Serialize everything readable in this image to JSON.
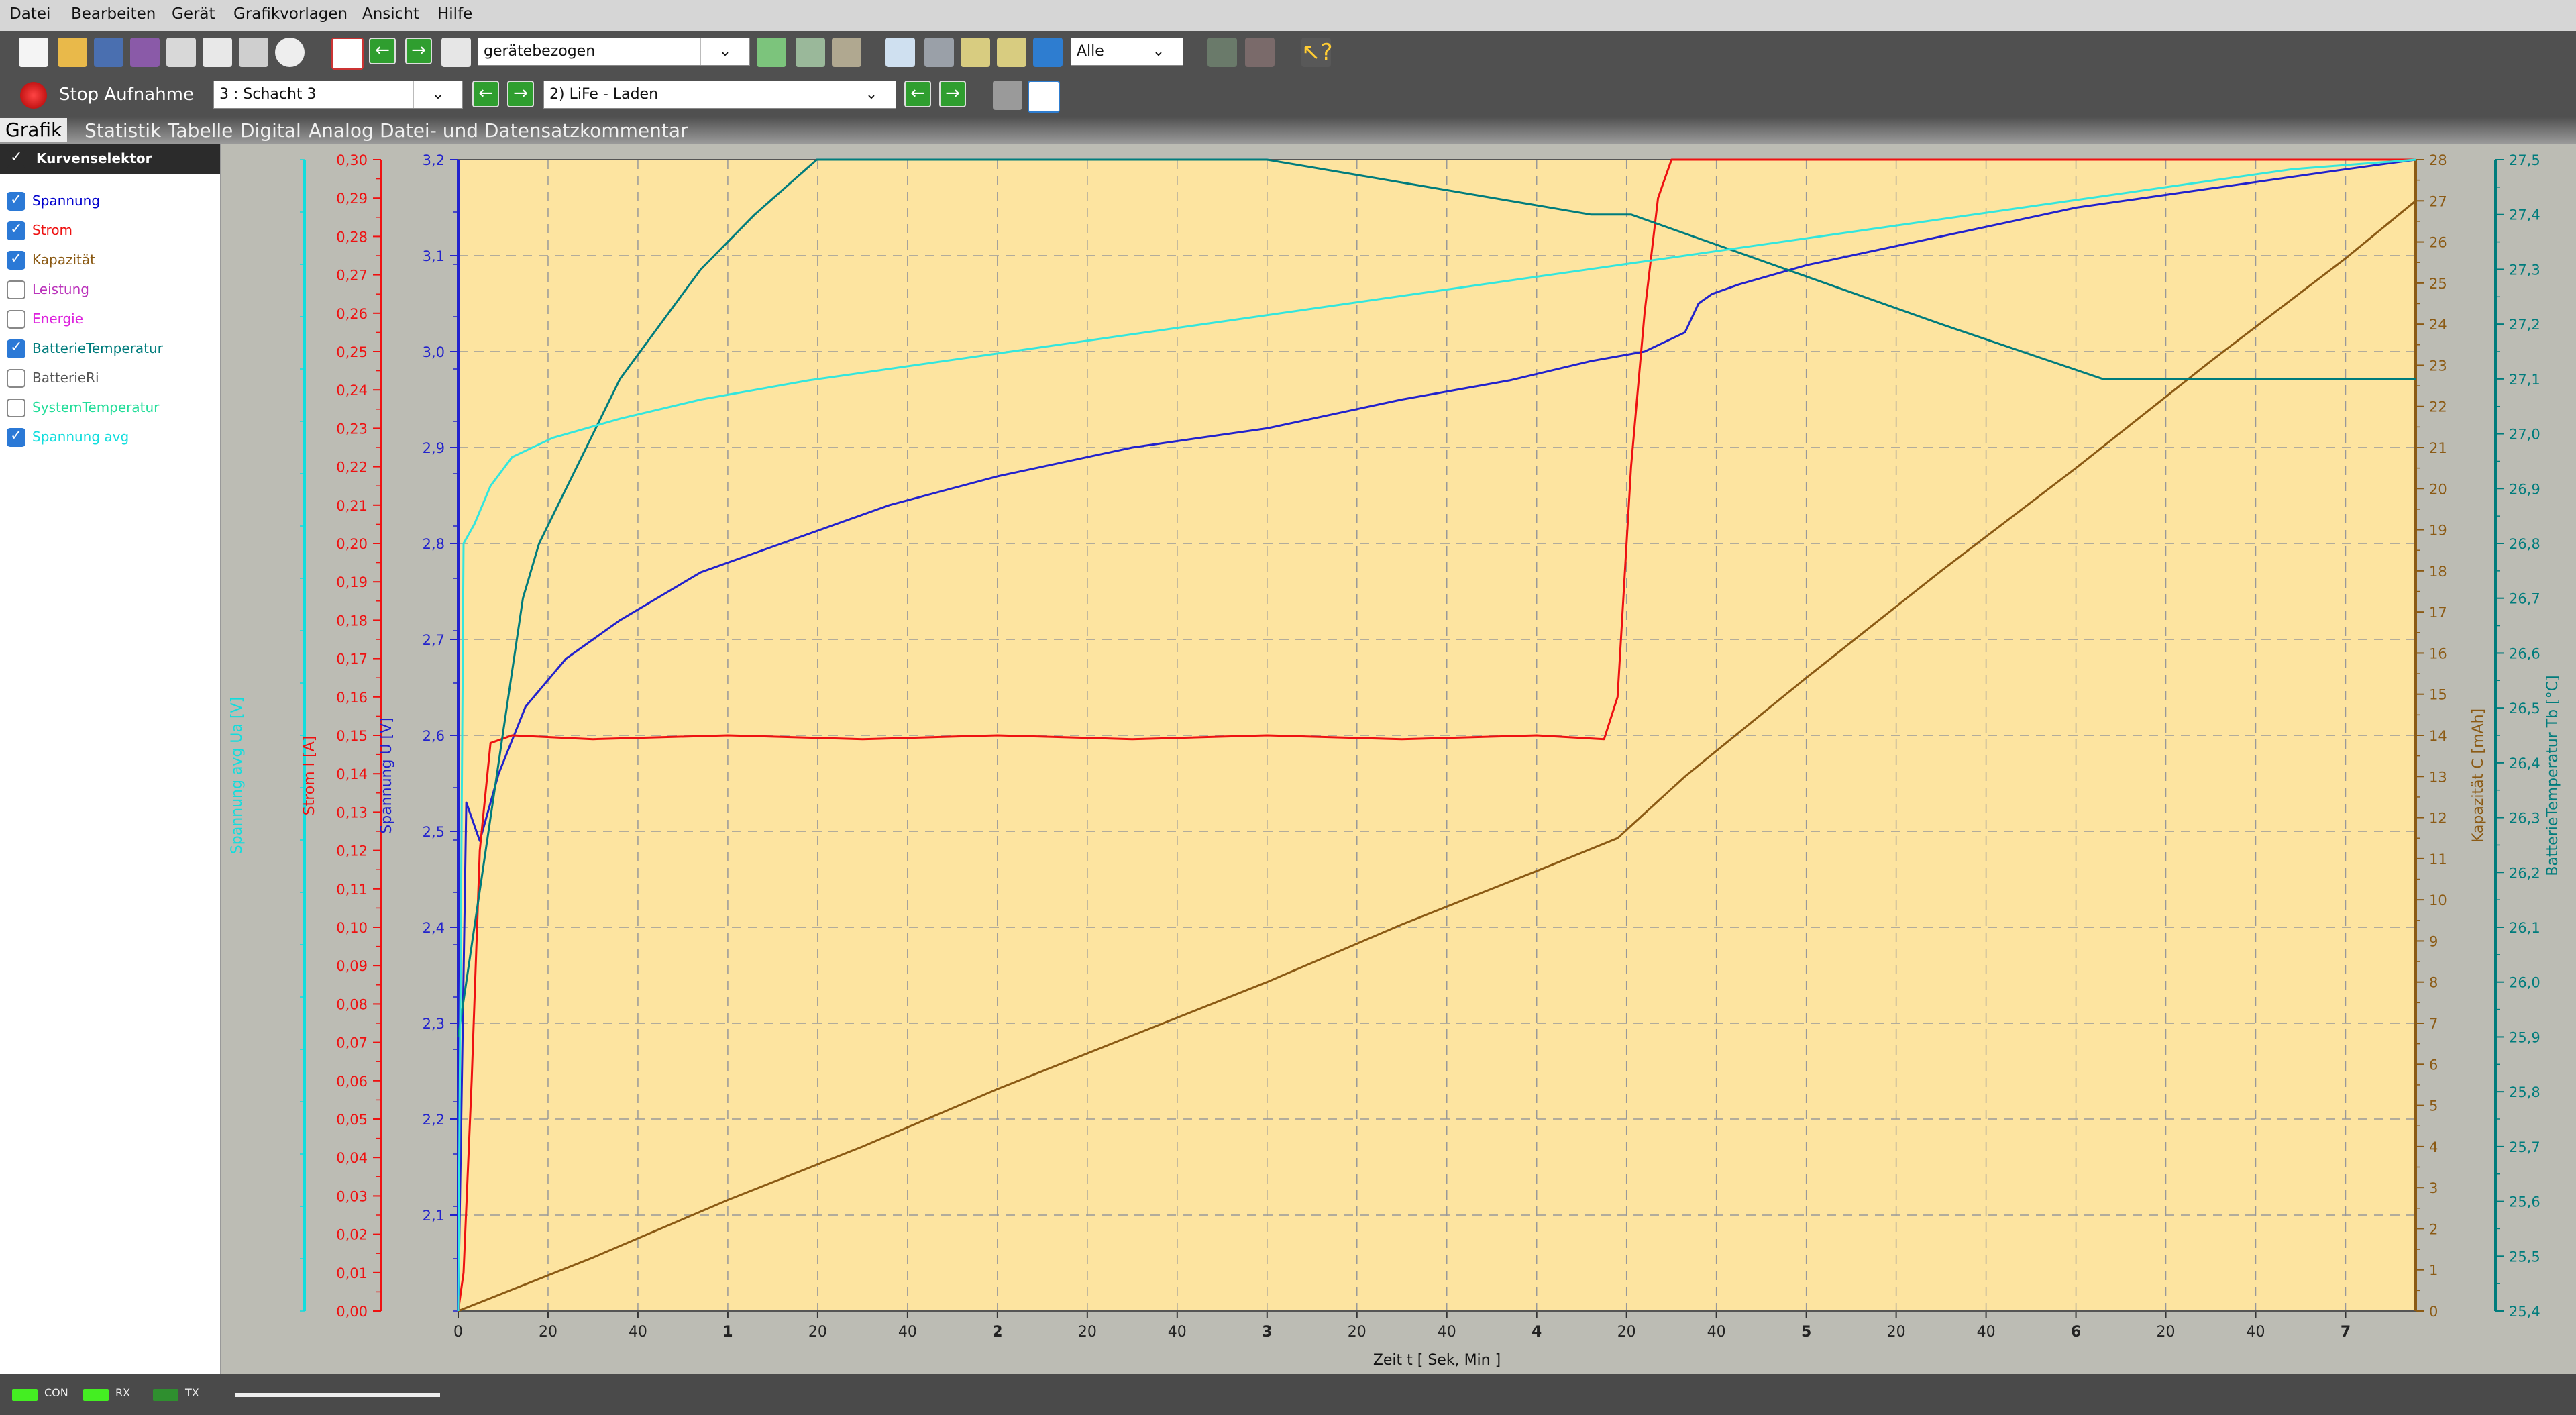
{
  "menu": [
    "Datei",
    "Bearbeiten",
    "Gerät",
    "Grafikvorlagen",
    "Ansicht",
    "Hilfe"
  ],
  "toolbar1": {
    "template_combo": "gerätebezogen",
    "filter_combo": "Alle"
  },
  "toolbar2": {
    "record_button": "Stop Aufnahme",
    "channel_combo": "3 : Schacht 3",
    "record_set_combo": "2) LiFe - Laden"
  },
  "tabs": [
    "Grafik",
    "Statistik",
    "Tabelle",
    "Digital",
    "Analog",
    "Datei- und Datensatzkommentar"
  ],
  "sidebar": {
    "header": "Kurvenselektor",
    "items": [
      {
        "label": "Spannung",
        "checked": true,
        "color": "#0000cc"
      },
      {
        "label": "Strom",
        "checked": true,
        "color": "#ee1111"
      },
      {
        "label": "Kapazität",
        "checked": true,
        "color": "#8b5a14"
      },
      {
        "label": "Leistung",
        "checked": false,
        "color": "#bb33bb"
      },
      {
        "label": "Energie",
        "checked": false,
        "color": "#dd22dd"
      },
      {
        "label": "BatterieTemperatur",
        "checked": true,
        "color": "#007c7c"
      },
      {
        "label": "BatterieRi",
        "checked": false,
        "color": "#555555"
      },
      {
        "label": "SystemTemperatur",
        "checked": false,
        "color": "#22dd99"
      },
      {
        "label": "Spannung avg",
        "checked": true,
        "color": "#11dddd"
      }
    ]
  },
  "status": {
    "con": "CON",
    "rx": "RX",
    "tx": "TX"
  },
  "chart_data": {
    "type": "line",
    "background": "#fde4a0",
    "grid": true,
    "xlabel": "Zeit   t   [ Sek, Min ]",
    "x_ticks": [
      "0",
      "20",
      "40",
      "1",
      "20",
      "40",
      "2",
      "20",
      "40",
      "3",
      "20",
      "40",
      "4",
      "20",
      "40",
      "5",
      "20",
      "40",
      "6",
      "20",
      "40",
      "7"
    ],
    "axes": [
      {
        "id": "spannung_avg",
        "label": "Spannung avg  Ua  [V]",
        "side": "left",
        "color": "#11dddd",
        "range": [
          0,
          3.2
        ]
      },
      {
        "id": "strom",
        "label": "Strom   I   [A]",
        "side": "left",
        "color": "#ee1111",
        "range": [
          0,
          0.3
        ],
        "ticks": [
          "0,00",
          "0,01",
          "0,02",
          "0,03",
          "0,04",
          "0,05",
          "0,06",
          "0,07",
          "0,08",
          "0,09",
          "0,10",
          "0,11",
          "0,12",
          "0,13",
          "0,14",
          "0,15",
          "0,16",
          "0,17",
          "0,18",
          "0,19",
          "0,20",
          "0,21",
          "0,22",
          "0,23",
          "0,24",
          "0,25",
          "0,26",
          "0,27",
          "0,28",
          "0,29",
          "0,30"
        ]
      },
      {
        "id": "spannung",
        "label": "Spannung   U   [V]",
        "side": "left",
        "color": "#2222cc",
        "range": [
          2.0,
          3.2
        ],
        "ticks": [
          "2,1",
          "2,2",
          "2,3",
          "2,4",
          "2,5",
          "2,6",
          "2,7",
          "2,8",
          "2,9",
          "3,0",
          "3,1",
          "3,2"
        ]
      },
      {
        "id": "kapazitaet",
        "label": "Kapazität   C   [mAh]",
        "side": "right",
        "color": "#8b5a14",
        "range": [
          0,
          28
        ],
        "ticks": [
          "0",
          "1",
          "2",
          "3",
          "4",
          "5",
          "6",
          "7",
          "8",
          "9",
          "10",
          "11",
          "12",
          "13",
          "14",
          "15",
          "16",
          "17",
          "18",
          "19",
          "20",
          "21",
          "22",
          "23",
          "24",
          "25",
          "26",
          "27",
          "28"
        ]
      },
      {
        "id": "temperatur",
        "label": "BatterieTemperatur   Tb   [°C]",
        "side": "right",
        "color": "#007c7c",
        "range": [
          25.4,
          27.5
        ],
        "ticks": [
          "25,4",
          "25,5",
          "25,6",
          "25,7",
          "25,8",
          "25,9",
          "26,0",
          "26,1",
          "26,2",
          "26,3",
          "26,4",
          "26,5",
          "26,6",
          "26,7",
          "26,8",
          "26,9",
          "27,0",
          "27,1",
          "27,2",
          "27,3",
          "27,4",
          "27,5"
        ]
      }
    ],
    "series": [
      {
        "name": "Spannung",
        "axis": "spannung",
        "color": "#2222cc",
        "x": [
          0,
          0.03,
          0.08,
          0.15,
          0.25,
          0.4,
          0.6,
          0.9,
          1.2,
          1.6,
          2.0,
          2.5,
          3.0,
          3.5,
          3.9,
          4.2,
          4.4,
          4.55,
          4.6,
          4.65,
          4.75,
          5.0,
          5.5,
          6.0,
          6.5,
          7.0,
          7.26
        ],
        "y": [
          2.0,
          2.53,
          2.49,
          2.56,
          2.63,
          2.68,
          2.72,
          2.77,
          2.8,
          2.84,
          2.87,
          2.9,
          2.92,
          2.95,
          2.97,
          2.99,
          3.0,
          3.02,
          3.05,
          3.06,
          3.07,
          3.09,
          3.12,
          3.15,
          3.17,
          3.19,
          3.2
        ]
      },
      {
        "name": "Strom",
        "axis": "strom",
        "color": "#ee1111",
        "x": [
          0,
          0.02,
          0.05,
          0.08,
          0.12,
          0.2,
          0.5,
          1.0,
          1.5,
          2.0,
          2.5,
          3.0,
          3.5,
          4.0,
          4.25,
          4.3,
          4.35,
          4.4,
          4.45,
          4.5,
          4.55,
          5.0,
          5.5,
          6.0,
          6.5,
          7.0,
          7.26
        ],
        "y": [
          0,
          0.01,
          0.06,
          0.12,
          0.148,
          0.15,
          0.149,
          0.15,
          0.149,
          0.15,
          0.149,
          0.15,
          0.149,
          0.15,
          0.149,
          0.16,
          0.22,
          0.26,
          0.29,
          0.3,
          0.3,
          0.3,
          0.3,
          0.3,
          0.3,
          0.3,
          0.3
        ]
      },
      {
        "name": "Kapazität",
        "axis": "kapazitaet",
        "color": "#8b5a14",
        "x": [
          0,
          0.5,
          1.0,
          1.5,
          2.0,
          2.5,
          3.0,
          3.5,
          4.0,
          4.3,
          4.55,
          5.0,
          5.5,
          6.0,
          6.5,
          7.0,
          7.26
        ],
        "y": [
          0,
          1.3,
          2.7,
          4.0,
          5.4,
          6.7,
          8.0,
          9.4,
          10.7,
          11.5,
          13.0,
          15.4,
          18.0,
          20.5,
          23.1,
          25.6,
          27
        ]
      },
      {
        "name": "BatterieTemperatur",
        "axis": "temperatur",
        "color": "#007c7c",
        "x": [
          0,
          0.03,
          0.06,
          0.09,
          0.12,
          0.15,
          0.18,
          0.21,
          0.24,
          0.3,
          0.4,
          0.5,
          0.6,
          0.75,
          0.9,
          1.1,
          1.33,
          1.7,
          2.3,
          2.55,
          2.62,
          3.0,
          4.2,
          4.35,
          5.5,
          6.1,
          7.26
        ],
        "y": [
          25.9,
          26.0,
          26.1,
          26.2,
          26.3,
          26.4,
          26.5,
          26.6,
          26.7,
          26.8,
          26.9,
          27.0,
          27.1,
          27.2,
          27.3,
          27.4,
          27.5,
          27.6,
          27.6,
          27.7,
          27.6,
          27.6,
          27.4,
          27.4,
          27.2,
          27.1,
          27.1
        ]
      },
      {
        "name": "Spannung avg",
        "axis": "spannung",
        "color": "#33e6dd",
        "x": [
          0,
          0.02,
          0.06,
          0.12,
          0.2,
          0.35,
          0.6,
          0.9,
          1.3,
          1.8,
          2.3,
          2.8,
          3.3,
          3.8,
          4.3,
          4.8,
          5.3,
          5.8,
          6.3,
          6.8,
          7.26
        ],
        "y": [
          2.0,
          2.8,
          2.82,
          2.86,
          2.89,
          2.91,
          2.93,
          2.95,
          2.97,
          2.99,
          3.01,
          3.03,
          3.05,
          3.07,
          3.09,
          3.11,
          3.13,
          3.15,
          3.17,
          3.19,
          3.2
        ]
      }
    ]
  }
}
